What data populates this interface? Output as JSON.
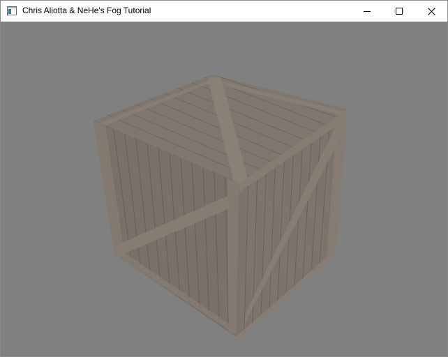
{
  "window": {
    "title": "Chris Aliotta & NeHe's Fog Tutorial",
    "controls": {
      "minimize_icon": "minimize-icon",
      "maximize_icon": "maximize-icon",
      "close_icon": "close-icon"
    }
  },
  "scene": {
    "fog_color": "#808080",
    "object": "wooden-crate",
    "wood_color": "#7c7268",
    "plank_line_color": "#5f564e",
    "brace_color": "#8a7f73"
  }
}
